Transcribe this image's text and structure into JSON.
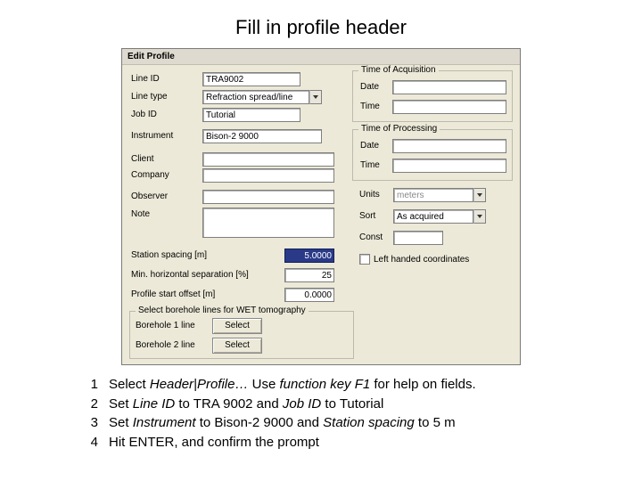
{
  "slide": {
    "title": "Fill in profile header"
  },
  "dialog": {
    "title": "Edit Profile",
    "labels": {
      "line_id": "Line ID",
      "line_type": "Line type",
      "job_id": "Job ID",
      "instrument": "Instrument",
      "client": "Client",
      "company": "Company",
      "observer": "Observer",
      "note": "Note",
      "station_spacing": "Station spacing [m]",
      "min_hsep": "Min. horizontal separation [%]",
      "profile_start": "Profile start offset [m]",
      "date": "Date",
      "time": "Time",
      "units": "Units",
      "sort": "Sort",
      "const": "Const"
    },
    "values": {
      "line_id": "TRA9002",
      "line_type": "Refraction spread/line",
      "job_id": "Tutorial",
      "instrument": "Bison-2 9000",
      "client": "",
      "company": "",
      "observer": "",
      "note": "",
      "station_spacing": "5.0000",
      "min_hsep": "25",
      "profile_start": "0.0000",
      "acq_date": "",
      "acq_time": "",
      "proc_date": "",
      "proc_time": "",
      "units": "meters",
      "sort": "As acquired",
      "const": ""
    },
    "groups": {
      "time_acq": "Time of Acquisition",
      "time_proc": "Time of Processing",
      "borehole": "Select borehole lines for WET tomography"
    },
    "checkbox": {
      "left_handed": "Left handed coordinates"
    },
    "borehole": {
      "line1_label": "Borehole 1 line",
      "line2_label": "Borehole 2 line",
      "select_btn": "Select"
    }
  },
  "steps": {
    "s1_a": "Select ",
    "s1_b": "Header|Profile…",
    "s1_c": " Use ",
    "s1_d": "function key F1",
    "s1_e": " for help on fields.",
    "s2_a": "Set ",
    "s2_b": "Line ID ",
    "s2_c": " to TRA 9002 and ",
    "s2_d": "Job ID ",
    "s2_e": " to Tutorial",
    "s3_a": "Set ",
    "s3_b": "Instrument ",
    "s3_c": " to Bison-2 9000 and ",
    "s3_d": "Station spacing ",
    "s3_e": " to 5 m",
    "s4": "Hit ENTER, and confirm the prompt"
  }
}
